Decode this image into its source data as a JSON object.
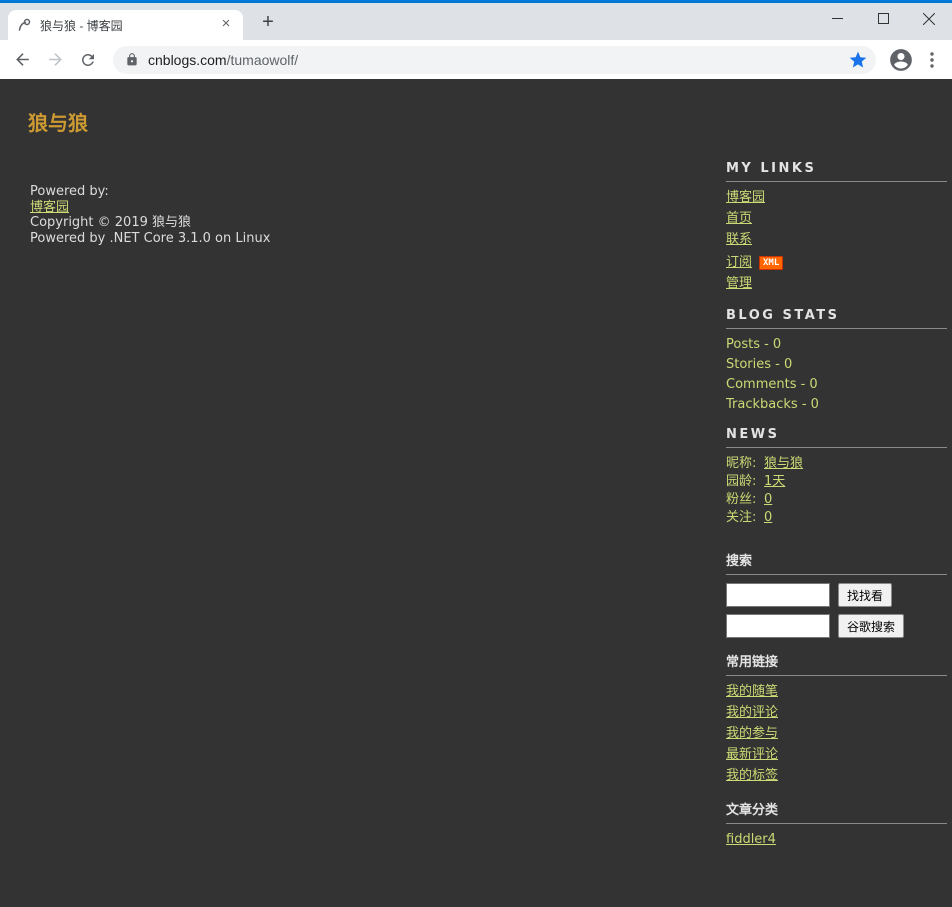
{
  "browser": {
    "accent_color": "#0078d7",
    "tab": {
      "title": "狼与狼 - 博客园",
      "close_glyph": "×"
    },
    "new_tab_glyph": "+",
    "address_bar": {
      "url_domain": "cnblogs.com",
      "url_path": "/tumaowolf/",
      "bookmark_star_color": "#1a73e8"
    }
  },
  "page": {
    "blog_title": "狼与狼",
    "footer": {
      "powered_by_label": "Powered by:",
      "platform_link": "博客园",
      "copyright": "Copyright © 2019 狼与狼",
      "tech_line": "Powered by .NET Core 3.1.0 on Linux"
    },
    "sidebar": {
      "my_links": {
        "title": "MY LINKS",
        "items": [
          "博客园",
          "首页",
          "联系",
          "订阅",
          "管理"
        ],
        "xml_badge": "XML"
      },
      "blog_stats": {
        "title": "BLOG STATS",
        "items": [
          "Posts - 0",
          "Stories - 0",
          "Comments - 0",
          "Trackbacks - 0"
        ]
      },
      "news": {
        "title": "NEWS",
        "rows": [
          {
            "label": "昵称:",
            "value": "狼与狼"
          },
          {
            "label": "园龄:",
            "value": "1天"
          },
          {
            "label": "粉丝:",
            "value": "0"
          },
          {
            "label": "关注:",
            "value": "0"
          }
        ]
      },
      "search": {
        "title": "搜索",
        "input1_value": "",
        "input2_value": "",
        "button1": "找找看",
        "button2": "谷歌搜索"
      },
      "common_links": {
        "title": "常用链接",
        "items": [
          "我的随笔",
          "我的评论",
          "我的参与",
          "最新评论",
          "我的标签"
        ]
      },
      "categories": {
        "title": "文章分类",
        "items": [
          "fiddler4"
        ]
      }
    },
    "colors": {
      "page_background": "#333333",
      "link_green": "#ccd974",
      "title_orange": "#cc9933",
      "body_text": "#dcdcdc",
      "xml_badge_bg": "#ff6600"
    }
  }
}
